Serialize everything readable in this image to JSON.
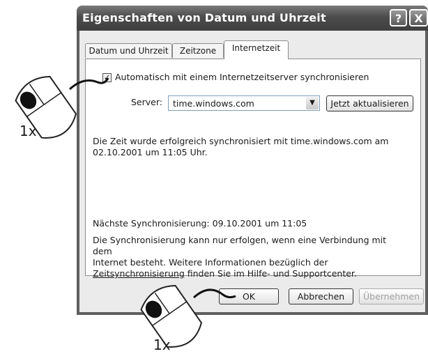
{
  "window": {
    "title": "Eigenschaften von Datum und Uhrzeit",
    "help_label": "?",
    "close_label": "X"
  },
  "tabs": [
    {
      "label": "Datum und Uhrzeit"
    },
    {
      "label": "Zeitzone"
    },
    {
      "label": "Internetzeit"
    }
  ],
  "internet_time": {
    "sync_checkbox_label": "Automatisch mit einem Internetzeitserver synchronisieren",
    "sync_checked": true,
    "server_label": "Server:",
    "server_value": "time.windows.com",
    "update_button": "Jetzt aktualisieren",
    "status_line1": "Die Zeit wurde erfolgreich synchronisiert mit time.windows.com am",
    "status_line2": "02.10.2001 um 11:05 Uhr.",
    "next_sync": "Nächste Synchronisierung: 09.10.2001 um 11:05",
    "info_line1": "Die Synchronisierung kann nur erfolgen, wenn eine Verbindung mit dem",
    "info_line2": "Internet besteht. Weitere Informationen bezüglich der",
    "info_link": "Zeitsynchronisierung",
    "info_line3_rest": " finden Sie im Hilfe- und Supportcenter."
  },
  "buttons": {
    "ok": "OK",
    "cancel": "Abbrechen",
    "apply": "Übernehmen"
  },
  "annotations": [
    {
      "label": "1x"
    },
    {
      "label": "1x"
    }
  ]
}
